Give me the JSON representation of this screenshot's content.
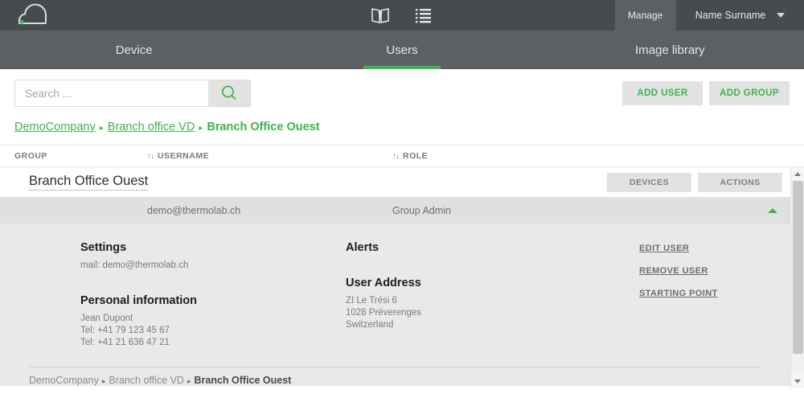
{
  "colors": {
    "accent_green": "#3cb54a",
    "topbar_bg": "#474b4e",
    "navbar_bg": "#5c6063",
    "panel_bg": "#e9e9e9",
    "row_bg": "#e0e0e0",
    "button_bg": "#e2e2e2"
  },
  "topbar": {
    "logo_name": "cloud-logo",
    "icons": [
      {
        "name": "book-icon",
        "label": "Book"
      },
      {
        "name": "list-icon",
        "label": "List"
      }
    ],
    "manage_label": "Manage",
    "user_name": "Name Surname"
  },
  "nav": {
    "tabs": [
      {
        "label": "Device",
        "active": false
      },
      {
        "label": "Users",
        "active": true
      },
      {
        "label": "Image library",
        "active": false
      }
    ]
  },
  "toolbar": {
    "search_placeholder": "Search ...",
    "search_value": "",
    "add_user_label": "ADD USER",
    "add_group_label": "ADD GROUP"
  },
  "breadcrumb": {
    "items": [
      "DemoCompany",
      "Branch office VD"
    ],
    "current": "Branch Office Ouest",
    "separator": "▸"
  },
  "table": {
    "headers": {
      "group": "GROUP",
      "username": "USERNAME",
      "role": "ROLE",
      "sort_glyph": "↑↓"
    }
  },
  "group": {
    "title": "Branch Office Ouest",
    "devices_label": "DEVICES",
    "actions_label": "ACTIONS"
  },
  "user_row": {
    "group": "",
    "username": "demo@thermolab.ch",
    "role": "Group Admin"
  },
  "detail": {
    "settings": {
      "heading": "Settings",
      "mail": "mail: demo@thermolab.ch"
    },
    "personal": {
      "heading": "Personal information",
      "name": "Jean Dupont",
      "tel1": "Tel: +41 79 123 45 67",
      "tel2": "Tel: +41 21 636 47 21"
    },
    "alerts": {
      "heading": "Alerts"
    },
    "address": {
      "heading": "User Address",
      "line1": "ZI Le Trési 6",
      "line2": "1028 Préverenges",
      "line3": "Switzerland"
    },
    "links": {
      "edit_user": "EDIT USER",
      "remove_user": "REMOVE USER",
      "starting_point": "STARTING POINT"
    }
  },
  "bottom_breadcrumb": {
    "items": [
      "DemoCompany",
      "Branch office VD"
    ],
    "current": "Branch Office Ouest",
    "separator": "▸"
  }
}
